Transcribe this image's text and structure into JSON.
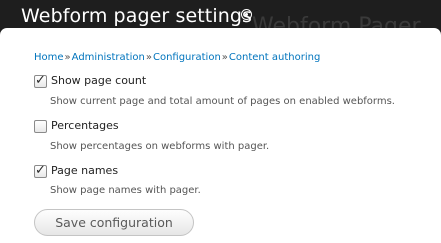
{
  "header": {
    "title": "Webform pager settings",
    "ghost_title": "Webform Pager",
    "shortcut_icon": "add-shortcut-icon"
  },
  "breadcrumb": {
    "items": [
      "Home",
      "Administration",
      "Configuration",
      "Content authoring"
    ],
    "separator": "»"
  },
  "options": [
    {
      "label": "Show page count",
      "description": "Show current page and total amount of pages on enabled webforms.",
      "checked": true
    },
    {
      "label": "Percentages",
      "description": "Show percentages on webforms with pager.",
      "checked": false
    },
    {
      "label": "Page names",
      "description": "Show page names with pager.",
      "checked": true
    }
  ],
  "actions": {
    "save_label": "Save configuration"
  },
  "colors": {
    "header_bg": "#1e1e1e",
    "link": "#0074bd",
    "description": "#555555"
  }
}
